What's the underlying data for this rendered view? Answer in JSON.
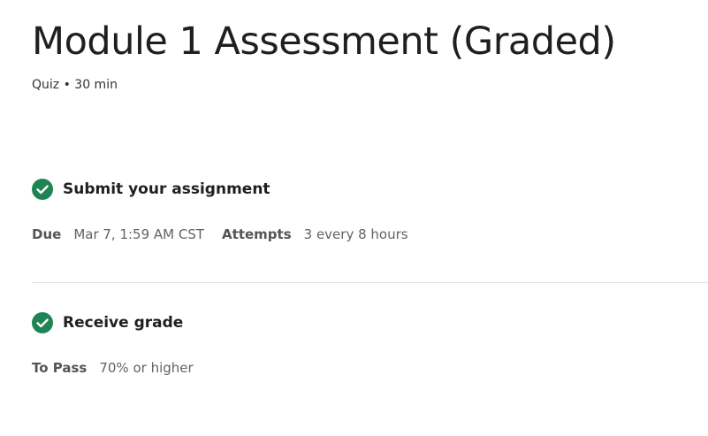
{
  "header": {
    "title": "Module 1 Assessment (Graded)",
    "meta": "Quiz • 30 min"
  },
  "steps": [
    {
      "icon": "check-circle-icon",
      "title": "Submit your assignment",
      "details": [
        {
          "label": "Due",
          "value": "Mar 7, 1:59 AM CST"
        },
        {
          "label": "Attempts",
          "value": "3 every 8 hours"
        }
      ]
    },
    {
      "icon": "check-circle-icon",
      "title": "Receive grade",
      "details": [
        {
          "label": "To Pass",
          "value": "70% or higher"
        }
      ]
    }
  ],
  "colors": {
    "check": "#1f8354",
    "text": "#1f1f1f",
    "muted": "#636363",
    "divider": "#e3e3e3"
  }
}
